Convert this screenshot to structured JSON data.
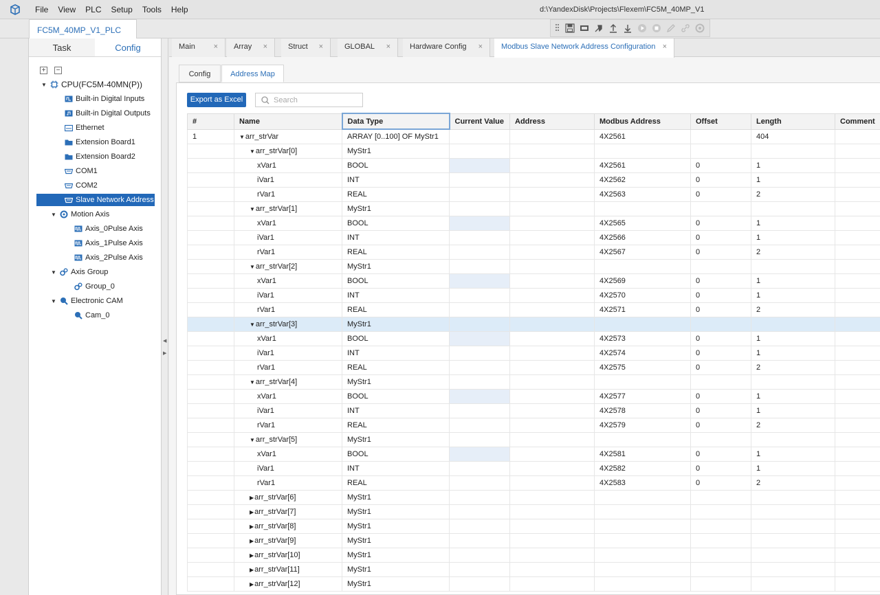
{
  "menu": [
    "File",
    "View",
    "PLC",
    "Setup",
    "Tools",
    "Help"
  ],
  "title_path": "d:\\YandexDisk\\Projects\\Flexem\\FC5M_40MP_V1",
  "project_tab": "FC5M_40MP_V1_PLC",
  "toolbar_icons": [
    "grip-icon",
    "save-icon",
    "compile-icon",
    "build-icon",
    "upload-icon",
    "download-icon",
    "run-icon",
    "stop-icon",
    "edit-icon",
    "link-icon",
    "settings-icon"
  ],
  "panel": {
    "tabs": [
      "Task",
      "Config"
    ],
    "active_tab": "Config",
    "expand_all": "+",
    "collapse_all": "−",
    "nodes": [
      {
        "label": "CPU(FC5M-40MN(P))",
        "icon": "cpu-icon",
        "depth": 0,
        "arrow": "▼"
      },
      {
        "label": "Built-in Digital Inputs",
        "icon": "digital-input-icon",
        "depth": 1,
        "arrow": ""
      },
      {
        "label": "Built-in Digital Outputs",
        "icon": "digital-output-icon",
        "depth": 1,
        "arrow": ""
      },
      {
        "label": "Ethernet",
        "icon": "ethernet-icon",
        "depth": 1,
        "arrow": ""
      },
      {
        "label": "Extension Board1",
        "icon": "folder-icon",
        "depth": 1,
        "arrow": ""
      },
      {
        "label": "Extension Board2",
        "icon": "folder-icon",
        "depth": 1,
        "arrow": ""
      },
      {
        "label": "COM1",
        "icon": "serial-port-icon",
        "depth": 1,
        "arrow": ""
      },
      {
        "label": "COM2",
        "icon": "serial-port-icon",
        "depth": 1,
        "arrow": ""
      },
      {
        "label": "Slave Network Address",
        "icon": "serial-port-icon",
        "depth": 1,
        "arrow": "",
        "selected": true
      },
      {
        "label": "Motion Axis",
        "icon": "gear-icon",
        "depth": 1,
        "arrow": "▼"
      },
      {
        "label": "Axis_0Pulse Axis",
        "icon": "pulse-axis-icon",
        "depth": 2,
        "arrow": ""
      },
      {
        "label": "Axis_1Pulse Axis",
        "icon": "pulse-axis-icon",
        "depth": 2,
        "arrow": ""
      },
      {
        "label": "Axis_2Pulse Axis",
        "icon": "pulse-axis-icon",
        "depth": 2,
        "arrow": ""
      },
      {
        "label": "Axis Group",
        "icon": "gears-icon",
        "depth": 1,
        "arrow": "▼"
      },
      {
        "label": "Group_0",
        "icon": "gears-icon",
        "depth": 2,
        "arrow": ""
      },
      {
        "label": "Electronic CAM",
        "icon": "cam-icon",
        "depth": 1,
        "arrow": "▼"
      },
      {
        "label": "Cam_0",
        "icon": "cam-icon",
        "depth": 2,
        "arrow": ""
      }
    ]
  },
  "doc_tabs": [
    {
      "label": "Main",
      "active": false
    },
    {
      "label": "Array",
      "active": false
    },
    {
      "label": "Struct",
      "active": false
    },
    {
      "label": "GLOBAL",
      "active": false
    },
    {
      "label": "Hardware Config",
      "active": false
    },
    {
      "label": "Modbus Slave Network Address Configuration",
      "active": true
    }
  ],
  "close_glyph": "×",
  "sub_tabs": [
    {
      "label": "Config",
      "active": false
    },
    {
      "label": "Address Map",
      "active": true
    }
  ],
  "export_label": "Export as Excel",
  "search": {
    "placeholder": "Search",
    "value": ""
  },
  "columns": [
    "#",
    "Name",
    "Data Type",
    "Current Value",
    "Address",
    "Modbus Address",
    "Offset",
    "Length",
    "Comment"
  ],
  "rows": [
    {
      "num": "1",
      "name": "arr_strVar",
      "toggle": "▼",
      "level": 0,
      "type": "ARRAY [0..100] OF MyStr1",
      "cv": "",
      "address": "",
      "modbus": "4X2561",
      "offset": "",
      "length": "404",
      "comment": ""
    },
    {
      "num": "",
      "name": "arr_strVar[0]",
      "toggle": "▼",
      "level": 1,
      "type": "MyStr1",
      "cv": "",
      "address": "",
      "modbus": "",
      "offset": "",
      "length": "",
      "comment": ""
    },
    {
      "num": "",
      "name": "xVar1",
      "toggle": "",
      "level": 2,
      "type": "BOOL",
      "cv": "",
      "cv_edit": true,
      "address": "",
      "modbus": "4X2561",
      "offset": "0",
      "length": "1",
      "comment": ""
    },
    {
      "num": "",
      "name": "iVar1",
      "toggle": "",
      "level": 2,
      "type": "INT",
      "cv": "",
      "address": "",
      "modbus": "4X2562",
      "offset": "0",
      "length": "1",
      "comment": ""
    },
    {
      "num": "",
      "name": "rVar1",
      "toggle": "",
      "level": 2,
      "type": "REAL",
      "cv": "",
      "address": "",
      "modbus": "4X2563",
      "offset": "0",
      "length": "2",
      "comment": ""
    },
    {
      "num": "",
      "name": "arr_strVar[1]",
      "toggle": "▼",
      "level": 1,
      "type": "MyStr1",
      "cv": "",
      "address": "",
      "modbus": "",
      "offset": "",
      "length": "",
      "comment": ""
    },
    {
      "num": "",
      "name": "xVar1",
      "toggle": "",
      "level": 2,
      "type": "BOOL",
      "cv": "",
      "cv_edit": true,
      "address": "",
      "modbus": "4X2565",
      "offset": "0",
      "length": "1",
      "comment": ""
    },
    {
      "num": "",
      "name": "iVar1",
      "toggle": "",
      "level": 2,
      "type": "INT",
      "cv": "",
      "address": "",
      "modbus": "4X2566",
      "offset": "0",
      "length": "1",
      "comment": ""
    },
    {
      "num": "",
      "name": "rVar1",
      "toggle": "",
      "level": 2,
      "type": "REAL",
      "cv": "",
      "address": "",
      "modbus": "4X2567",
      "offset": "0",
      "length": "2",
      "comment": ""
    },
    {
      "num": "",
      "name": "arr_strVar[2]",
      "toggle": "▼",
      "level": 1,
      "type": "MyStr1",
      "cv": "",
      "address": "",
      "modbus": "",
      "offset": "",
      "length": "",
      "comment": ""
    },
    {
      "num": "",
      "name": "xVar1",
      "toggle": "",
      "level": 2,
      "type": "BOOL",
      "cv": "",
      "cv_edit": true,
      "address": "",
      "modbus": "4X2569",
      "offset": "0",
      "length": "1",
      "comment": ""
    },
    {
      "num": "",
      "name": "iVar1",
      "toggle": "",
      "level": 2,
      "type": "INT",
      "cv": "",
      "address": "",
      "modbus": "4X2570",
      "offset": "0",
      "length": "1",
      "comment": ""
    },
    {
      "num": "",
      "name": "rVar1",
      "toggle": "",
      "level": 2,
      "type": "REAL",
      "cv": "",
      "address": "",
      "modbus": "4X2571",
      "offset": "0",
      "length": "2",
      "comment": ""
    },
    {
      "num": "",
      "name": "arr_strVar[3]",
      "toggle": "▼",
      "level": 1,
      "type": "MyStr1",
      "cv": "",
      "address": "",
      "modbus": "",
      "offset": "",
      "length": "",
      "comment": "",
      "highlight": true
    },
    {
      "num": "",
      "name": "xVar1",
      "toggle": "",
      "level": 2,
      "type": "BOOL",
      "cv": "",
      "cv_edit": true,
      "address": "",
      "modbus": "4X2573",
      "offset": "0",
      "length": "1",
      "comment": ""
    },
    {
      "num": "",
      "name": "iVar1",
      "toggle": "",
      "level": 2,
      "type": "INT",
      "cv": "",
      "address": "",
      "modbus": "4X2574",
      "offset": "0",
      "length": "1",
      "comment": ""
    },
    {
      "num": "",
      "name": "rVar1",
      "toggle": "",
      "level": 2,
      "type": "REAL",
      "cv": "",
      "address": "",
      "modbus": "4X2575",
      "offset": "0",
      "length": "2",
      "comment": ""
    },
    {
      "num": "",
      "name": "arr_strVar[4]",
      "toggle": "▼",
      "level": 1,
      "type": "MyStr1",
      "cv": "",
      "address": "",
      "modbus": "",
      "offset": "",
      "length": "",
      "comment": ""
    },
    {
      "num": "",
      "name": "xVar1",
      "toggle": "",
      "level": 2,
      "type": "BOOL",
      "cv": "",
      "cv_edit": true,
      "address": "",
      "modbus": "4X2577",
      "offset": "0",
      "length": "1",
      "comment": ""
    },
    {
      "num": "",
      "name": "iVar1",
      "toggle": "",
      "level": 2,
      "type": "INT",
      "cv": "",
      "address": "",
      "modbus": "4X2578",
      "offset": "0",
      "length": "1",
      "comment": ""
    },
    {
      "num": "",
      "name": "rVar1",
      "toggle": "",
      "level": 2,
      "type": "REAL",
      "cv": "",
      "address": "",
      "modbus": "4X2579",
      "offset": "0",
      "length": "2",
      "comment": ""
    },
    {
      "num": "",
      "name": "arr_strVar[5]",
      "toggle": "▼",
      "level": 1,
      "type": "MyStr1",
      "cv": "",
      "address": "",
      "modbus": "",
      "offset": "",
      "length": "",
      "comment": ""
    },
    {
      "num": "",
      "name": "xVar1",
      "toggle": "",
      "level": 2,
      "type": "BOOL",
      "cv": "",
      "cv_edit": true,
      "address": "",
      "modbus": "4X2581",
      "offset": "0",
      "length": "1",
      "comment": ""
    },
    {
      "num": "",
      "name": "iVar1",
      "toggle": "",
      "level": 2,
      "type": "INT",
      "cv": "",
      "address": "",
      "modbus": "4X2582",
      "offset": "0",
      "length": "1",
      "comment": ""
    },
    {
      "num": "",
      "name": "rVar1",
      "toggle": "",
      "level": 2,
      "type": "REAL",
      "cv": "",
      "address": "",
      "modbus": "4X2583",
      "offset": "0",
      "length": "2",
      "comment": ""
    },
    {
      "num": "",
      "name": "arr_strVar[6]",
      "toggle": "▶",
      "level": 1,
      "type": "MyStr1",
      "cv": "",
      "address": "",
      "modbus": "",
      "offset": "",
      "length": "",
      "comment": ""
    },
    {
      "num": "",
      "name": "arr_strVar[7]",
      "toggle": "▶",
      "level": 1,
      "type": "MyStr1",
      "cv": "",
      "address": "",
      "modbus": "",
      "offset": "",
      "length": "",
      "comment": ""
    },
    {
      "num": "",
      "name": "arr_strVar[8]",
      "toggle": "▶",
      "level": 1,
      "type": "MyStr1",
      "cv": "",
      "address": "",
      "modbus": "",
      "offset": "",
      "length": "",
      "comment": ""
    },
    {
      "num": "",
      "name": "arr_strVar[9]",
      "toggle": "▶",
      "level": 1,
      "type": "MyStr1",
      "cv": "",
      "address": "",
      "modbus": "",
      "offset": "",
      "length": "",
      "comment": ""
    },
    {
      "num": "",
      "name": "arr_strVar[10]",
      "toggle": "▶",
      "level": 1,
      "type": "MyStr1",
      "cv": "",
      "address": "",
      "modbus": "",
      "offset": "",
      "length": "",
      "comment": ""
    },
    {
      "num": "",
      "name": "arr_strVar[11]",
      "toggle": "▶",
      "level": 1,
      "type": "MyStr1",
      "cv": "",
      "address": "",
      "modbus": "",
      "offset": "",
      "length": "",
      "comment": ""
    },
    {
      "num": "",
      "name": "arr_strVar[12]",
      "toggle": "▶",
      "level": 1,
      "type": "MyStr1",
      "cv": "",
      "address": "",
      "modbus": "",
      "offset": "",
      "length": "",
      "comment": ""
    }
  ],
  "colors": {
    "accent": "#2268b8",
    "tab_text": "#2c6fb7",
    "row_highlight": "#dcebf8"
  }
}
